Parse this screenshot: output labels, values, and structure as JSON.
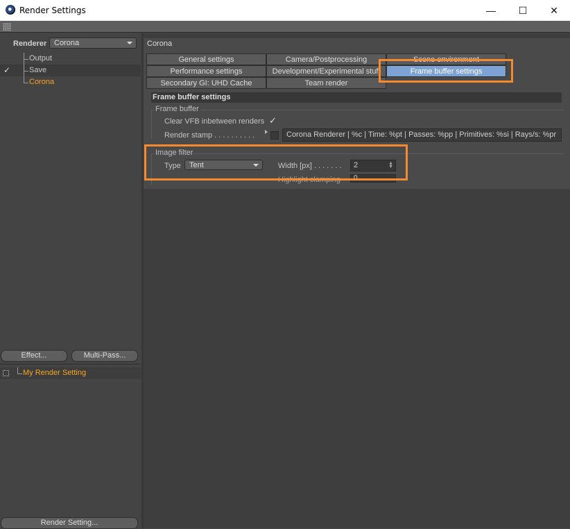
{
  "window": {
    "title": "Render Settings",
    "minimize": "—",
    "maximize": "☐",
    "close": "✕"
  },
  "left": {
    "renderer_label": "Renderer",
    "renderer_value": "Corona",
    "tree": [
      {
        "label": "Output",
        "checked": false
      },
      {
        "label": "Save",
        "checked": true,
        "check": "✓"
      },
      {
        "label": "Corona",
        "checked": false
      }
    ],
    "effect_button": "Effect...",
    "multipass_button": "Multi-Pass...",
    "setting_name": "My Render Setting",
    "render_setting_button": "Render Setting..."
  },
  "right": {
    "header": "Corona",
    "tabs": [
      {
        "label": "General settings",
        "active": false
      },
      {
        "label": "Camera/Postprocessing",
        "active": false
      },
      {
        "label": "Scene environment",
        "active": false
      },
      {
        "label": "Performance settings",
        "active": false
      },
      {
        "label": "Development/Experimental stuff",
        "active": false
      },
      {
        "label": "Frame buffer settings",
        "active": true
      },
      {
        "label": "Secondary GI: UHD Cache",
        "active": false
      },
      {
        "label": "Team render",
        "active": false
      }
    ],
    "section_title": "Frame buffer settings",
    "frame_buffer": {
      "group_title": "Frame buffer",
      "clear_vfb_label": "Clear VFB inbetween renders",
      "clear_vfb_check": "✓",
      "render_stamp_label": "Render stamp . . . . . . . . . .",
      "render_stamp_value": "Corona Renderer | %c | Time: %pt | Passes: %pp | Primitives: %si | Rays/s: %pr"
    },
    "image_filter": {
      "group_title": "Image filter",
      "type_label": "Type",
      "type_value": "Tent",
      "width_label": "Width [px] . . . . . . .",
      "width_value": "2",
      "highlight_label": "Highlight clamping",
      "highlight_value": "0"
    }
  },
  "colors": {
    "highlight": "#f58a2e",
    "active_tab": "#7da3d4",
    "selected_text": "#f5a623"
  }
}
